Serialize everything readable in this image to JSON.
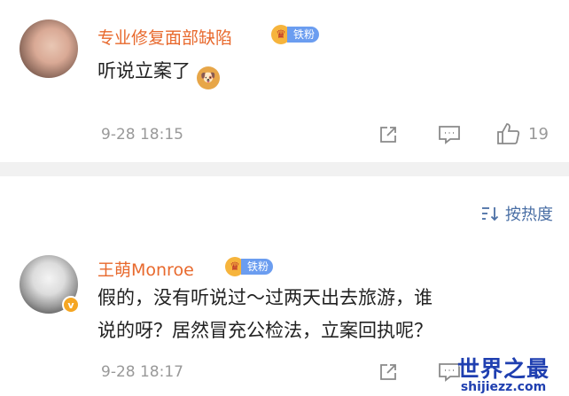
{
  "comments": [
    {
      "username": "专业修复面部缺陷",
      "fan_badge": "铁粉",
      "text": "听说立案了",
      "emoji": "doge-emoji",
      "timestamp": "9-28 18:15",
      "like_count": "19"
    },
    {
      "username": "王萌Monroe",
      "fan_badge": "铁粉",
      "avatar_badge": "v",
      "text_line1": "假的，没有听说过～过两天出去旅游，谁",
      "text_line2": "说的呀？居然冒充公检法，立案回执呢？",
      "timestamp": "9-28 18:17"
    }
  ],
  "sort": {
    "label": "按热度"
  },
  "watermark": {
    "main": "世界之最",
    "sub": "shijiezz.com"
  },
  "colors": {
    "username": "#e8692d",
    "fan_badge": "#6b9df0",
    "sort_link": "#4a6fa5",
    "watermark": "#1f3fb0"
  },
  "icons": [
    "share-icon",
    "comment-icon",
    "like-icon",
    "sort-icon",
    "crown-icon"
  ]
}
